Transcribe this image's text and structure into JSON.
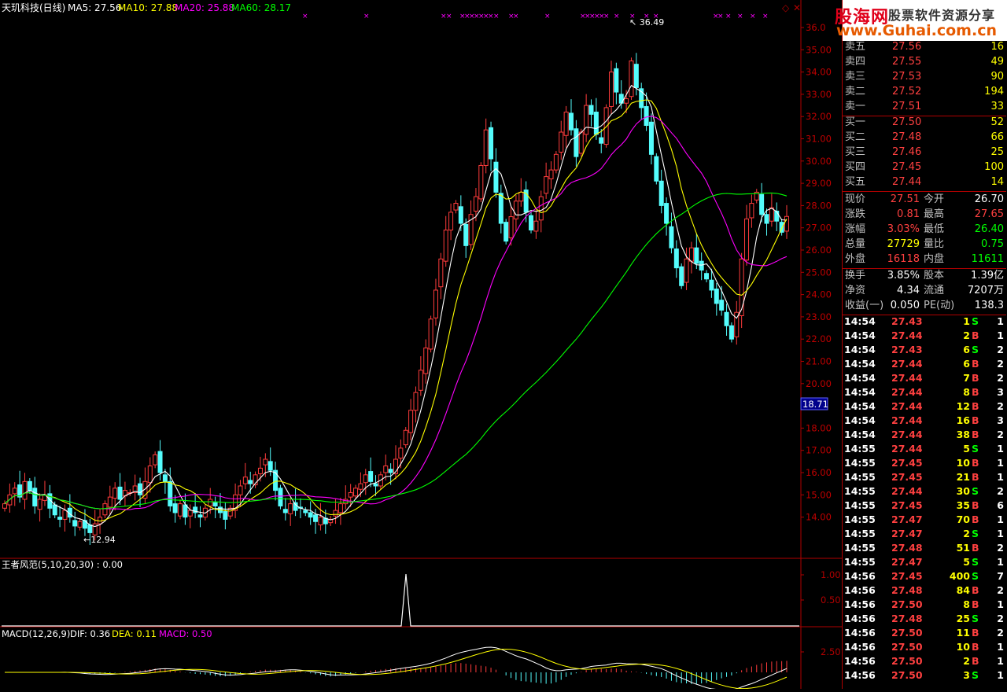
{
  "header": {
    "stock": "天玑科技(日线)",
    "ma5": "MA5: 27.56",
    "ma10": "MA10: 27.88",
    "ma20": "MA20: 25.88",
    "ma60": "MA60: 28.17",
    "high_mark": "36.49",
    "low_mark": "12.94",
    "cursor_price": "18.71"
  },
  "colors": {
    "up": "#ff3c3c",
    "down": "#54fcfc",
    "ma5": "#ffffff",
    "ma10": "#ffff00",
    "ma20": "#ff00ff",
    "ma60": "#00ff00",
    "axis": "#b00000"
  },
  "price_axis": [
    "36.0",
    "35.00",
    "34.00",
    "33.00",
    "32.00",
    "31.00",
    "30.00",
    "29.00",
    "28.00",
    "27.00",
    "26.00",
    "25.00",
    "24.00",
    "23.00",
    "22.00",
    "21.00",
    "20.00",
    "18.00",
    "17.00",
    "16.00",
    "15.00",
    "14.00"
  ],
  "indicator1": {
    "title": "王者风范(5,10,20,30) : 0.00",
    "ticks": [
      "1.00",
      "0.50"
    ]
  },
  "macd": {
    "title": "MACD(12,26,9)",
    "dif": "DIF: 0.36",
    "dea": "DEA: 0.11",
    "macd": "MACD: 0.50",
    "tick": "2.50"
  },
  "logo": {
    "brand": "股海网",
    "slogan": "股票软件资源分享",
    "url": "www.Guhai.com.cn"
  },
  "orderbook": {
    "asks": [
      {
        "label": "卖五",
        "price": "27.56",
        "vol": "16"
      },
      {
        "label": "卖四",
        "price": "27.55",
        "vol": "49"
      },
      {
        "label": "卖三",
        "price": "27.53",
        "vol": "90"
      },
      {
        "label": "卖二",
        "price": "27.52",
        "vol": "194"
      },
      {
        "label": "卖一",
        "price": "27.51",
        "vol": "33"
      }
    ],
    "bids": [
      {
        "label": "买一",
        "price": "27.50",
        "vol": "52"
      },
      {
        "label": "买二",
        "price": "27.48",
        "vol": "66"
      },
      {
        "label": "买三",
        "price": "27.46",
        "vol": "25"
      },
      {
        "label": "买四",
        "price": "27.45",
        "vol": "100"
      },
      {
        "label": "买五",
        "price": "27.44",
        "vol": "14"
      }
    ]
  },
  "quote": [
    {
      "l1": "现价",
      "v1": "27.51",
      "l2": "今开",
      "v2": "26.70"
    },
    {
      "l1": "涨跌",
      "v1": "0.81",
      "l2": "最高",
      "v2": "27.65"
    },
    {
      "l1": "涨幅",
      "v1": "3.03%",
      "l2": "最低",
      "v2": "26.40"
    },
    {
      "l1": "总量",
      "v1": "27729",
      "l2": "量比",
      "v2": "0.75"
    },
    {
      "l1": "外盘",
      "v1": "16118",
      "l2": "内盘",
      "v2": "11611"
    }
  ],
  "fundamentals": [
    {
      "l1": "换手",
      "v1": "3.85%",
      "l2": "股本",
      "v2": "1.39亿"
    },
    {
      "l1": "净资",
      "v1": "4.34",
      "l2": "流通",
      "v2": "7207万"
    },
    {
      "l1": "收益(一)",
      "v1": "0.050",
      "l2": "PE(动)",
      "v2": "138.3"
    }
  ],
  "ticks": [
    {
      "t": "14:54",
      "p": "27.43",
      "v": "1",
      "s": "S",
      "n": "1"
    },
    {
      "t": "14:54",
      "p": "27.44",
      "v": "2",
      "s": "B",
      "n": "1"
    },
    {
      "t": "14:54",
      "p": "27.43",
      "v": "6",
      "s": "S",
      "n": "2"
    },
    {
      "t": "14:54",
      "p": "27.44",
      "v": "6",
      "s": "B",
      "n": "2"
    },
    {
      "t": "14:54",
      "p": "27.44",
      "v": "7",
      "s": "B",
      "n": "2"
    },
    {
      "t": "14:54",
      "p": "27.44",
      "v": "8",
      "s": "B",
      "n": "3"
    },
    {
      "t": "14:54",
      "p": "27.44",
      "v": "12",
      "s": "B",
      "n": "2"
    },
    {
      "t": "14:54",
      "p": "27.44",
      "v": "16",
      "s": "B",
      "n": "3"
    },
    {
      "t": "14:54",
      "p": "27.44",
      "v": "38",
      "s": "B",
      "n": "2"
    },
    {
      "t": "14:55",
      "p": "27.44",
      "v": "5",
      "s": "S",
      "n": "1"
    },
    {
      "t": "14:55",
      "p": "27.45",
      "v": "10",
      "s": "B",
      "n": "1"
    },
    {
      "t": "14:55",
      "p": "27.45",
      "v": "21",
      "s": "B",
      "n": "1"
    },
    {
      "t": "14:55",
      "p": "27.44",
      "v": "30",
      "s": "S",
      "n": "2"
    },
    {
      "t": "14:55",
      "p": "27.45",
      "v": "35",
      "s": "B",
      "n": "6"
    },
    {
      "t": "14:55",
      "p": "27.47",
      "v": "70",
      "s": "B",
      "n": "1"
    },
    {
      "t": "14:55",
      "p": "27.47",
      "v": "2",
      "s": "S",
      "n": "1"
    },
    {
      "t": "14:55",
      "p": "27.48",
      "v": "51",
      "s": "B",
      "n": "2"
    },
    {
      "t": "14:55",
      "p": "27.47",
      "v": "5",
      "s": "S",
      "n": "1"
    },
    {
      "t": "14:56",
      "p": "27.45",
      "v": "400",
      "s": "S",
      "n": "7"
    },
    {
      "t": "14:56",
      "p": "27.48",
      "v": "84",
      "s": "B",
      "n": "2"
    },
    {
      "t": "14:56",
      "p": "27.50",
      "v": "8",
      "s": "B",
      "n": "1"
    },
    {
      "t": "14:56",
      "p": "27.48",
      "v": "25",
      "s": "S",
      "n": "2"
    },
    {
      "t": "14:56",
      "p": "27.50",
      "v": "11",
      "s": "B",
      "n": "2"
    },
    {
      "t": "14:56",
      "p": "27.50",
      "v": "10",
      "s": "B",
      "n": "1"
    },
    {
      "t": "14:56",
      "p": "27.50",
      "v": "2",
      "s": "B",
      "n": "1"
    },
    {
      "t": "14:56",
      "p": "27.50",
      "v": "3",
      "s": "S",
      "n": "1"
    }
  ]
}
